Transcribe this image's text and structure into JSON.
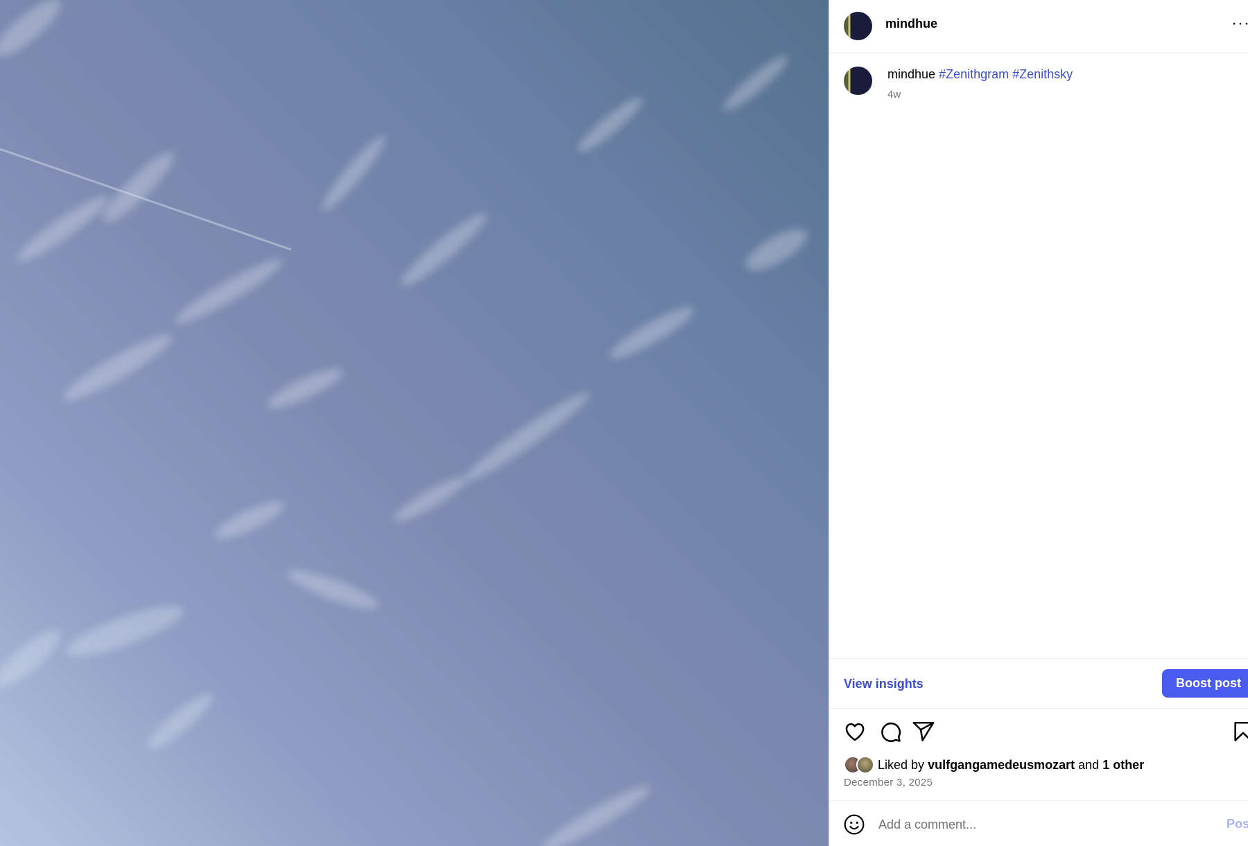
{
  "post": {
    "username": "mindhue",
    "caption_username": "mindhue",
    "hashtags": [
      "#Zenithgram",
      "#Zenithsky"
    ],
    "time_ago": "4w",
    "date": "December 3, 2025"
  },
  "insights": {
    "view_label": "View insights",
    "boost_label": "Boost post"
  },
  "likes": {
    "prefix": "Liked by",
    "user": "vulfgangamedeusmozart",
    "conjunction": "and",
    "others": "1 other"
  },
  "comment": {
    "placeholder": "Add a comment...",
    "post_label": "Post"
  },
  "icons": {
    "more": "more-options-icon",
    "like": "heart-icon",
    "comment": "comment-bubble-icon",
    "share": "share-icon",
    "save": "bookmark-icon",
    "emoji": "emoji-icon"
  },
  "colors": {
    "link": "#3b4cd8",
    "primary_button": "#4a5cf0",
    "secondary_text": "#737373"
  }
}
